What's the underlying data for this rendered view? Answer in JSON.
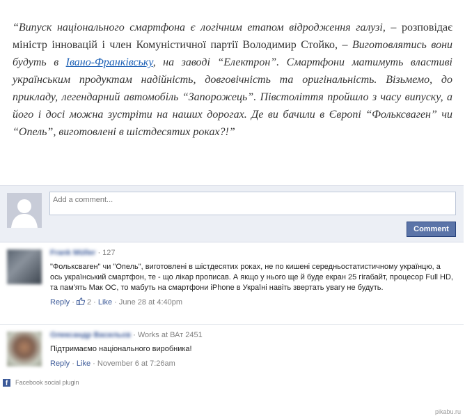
{
  "article": {
    "part1": "“Випуск національного смартфона є логічним етапом відродження галузі,",
    "part2": " – розповідає міністр інновацій і член Комуністичної партії Володимир Стойко, – ",
    "part3": "Виготовлятись вони будуть в ",
    "link": "Івано-Франківську",
    "part4": ", на заводі “Електрон”. Смартфони матимуть властиві українським продуктам надійність, довговічність та оригінальність. Візьмемо, до прикладу, легендарний автомобіль “Запорожець”. Півстоліття пройшло з часу випуску, а його і досі можна зустріти на наших дорогах. Де ви бачили в Європі “Фольксваген” чи “Опель”, виготовлені в шістдесятих роках?!”"
  },
  "compose": {
    "placeholder": "Add a comment...",
    "button_label": "Comment"
  },
  "comments": [
    {
      "author": "Frank Müller",
      "meta": " · 127",
      "text": "\"Фольксваген\" чи \"Опель\", виготовлені в шістдесятих роках, не по кишені середньостатистичному українцю, а ось український смартфон, те - що лікар прописав. А якщо у нього ще й буде екран 25 гігабайт, процесор Full HD, та пам'ять Мак ОС, то мабуть на смартфони iPhone в Україні навіть звертать увагу не будуть.",
      "reply": "Reply",
      "like_count": "2",
      "like": "Like",
      "date": "June 28 at 4:40pm"
    },
    {
      "author": "Олександр Васильєв",
      "meta": " · Works at ВАт 2451",
      "text": "Підтримаємо національного виробника!",
      "reply": "Reply",
      "like": "Like",
      "date": "November 6 at 7:26am"
    }
  ],
  "footer": {
    "plugin_text": "Facebook social plugin",
    "watermark": "pikabu.ru"
  },
  "colors": {
    "link": "#1b5fb5",
    "fb_blue": "#3b5998",
    "button": "#5b74a8"
  }
}
